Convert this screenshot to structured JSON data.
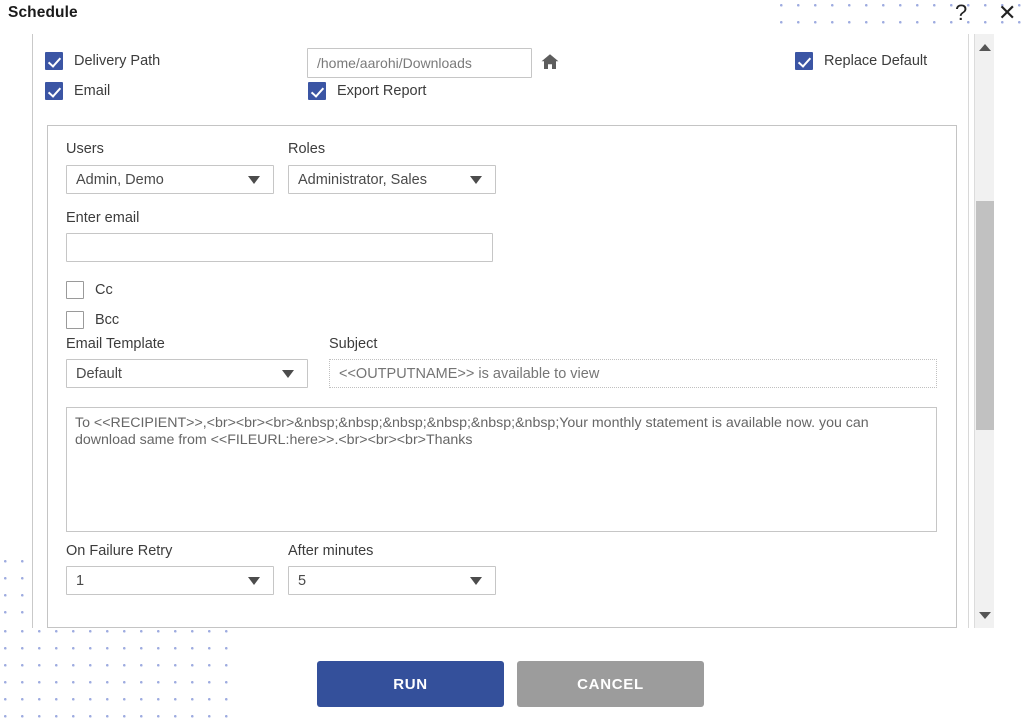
{
  "window": {
    "title": "Schedule",
    "help_icon": "question-mark-icon",
    "close_icon": "close-icon"
  },
  "top_controls": {
    "delivery_path": {
      "label": "Delivery Path",
      "checked": true
    },
    "email": {
      "label": "Email",
      "checked": true
    },
    "export_report": {
      "label": "Export Report",
      "checked": true
    },
    "replace_default": {
      "label": "Replace Default",
      "checked": true
    },
    "path_value": "/home/aarohi/Downloads",
    "path_placeholder": "",
    "home_icon": "home-icon"
  },
  "form": {
    "users": {
      "label": "Users",
      "value": "Admin, Demo"
    },
    "roles": {
      "label": "Roles",
      "value": "Administrator, Sales"
    },
    "enter_email": {
      "label": "Enter email",
      "value": "",
      "placeholder": ""
    },
    "cc": {
      "label": "Cc",
      "checked": false
    },
    "bcc": {
      "label": "Bcc",
      "checked": false
    },
    "email_template": {
      "label": "Email Template",
      "value": "Default"
    },
    "subject": {
      "label": "Subject",
      "value": "",
      "placeholder": "<<OUTPUTNAME>> is available to view"
    },
    "body": {
      "value": "To <<RECIPIENT>>,<br><br><br>&nbsp;&nbsp;&nbsp;&nbsp;&nbsp;&nbsp;Your monthly statement is available now. you can download same from <<FILEURL:here>>.<br><br><br>Thanks"
    },
    "on_failure_retry": {
      "label": "On Failure Retry",
      "value": "1"
    },
    "after_minutes": {
      "label": "After minutes",
      "value": "5"
    }
  },
  "footer": {
    "run_label": "RUN",
    "cancel_label": "CANCEL"
  },
  "colors": {
    "accent_blue": "#34509b",
    "checkbox_blue": "#3b55a4",
    "cancel_gray": "#9c9c9c",
    "dot_pattern": "#8e9ddb"
  }
}
